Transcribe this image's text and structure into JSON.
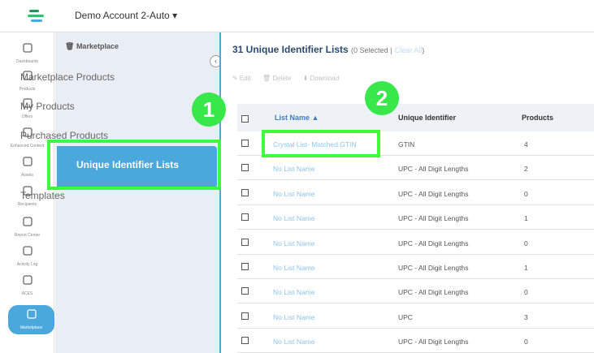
{
  "header": {
    "account_name": "Demo Account 2-Auto ▾"
  },
  "rail": {
    "items": [
      {
        "label": "Dashboards",
        "icon": "dashboard-icon"
      },
      {
        "label": "Products",
        "icon": "products-icon"
      },
      {
        "label": "Offers",
        "icon": "offers-icon"
      },
      {
        "label": "Enhanced Content",
        "icon": "enhanced-content-icon"
      },
      {
        "label": "Assets",
        "icon": "assets-icon"
      },
      {
        "label": "Recipients",
        "icon": "recipients-icon"
      },
      {
        "label": "Report Center",
        "icon": "report-center-icon"
      },
      {
        "label": "Activity Log",
        "icon": "activity-log-icon"
      },
      {
        "label": "ACES",
        "icon": "aces-icon"
      },
      {
        "label": "Marketplace",
        "icon": "marketplace-icon"
      }
    ]
  },
  "subnav": {
    "heading": "Marketplace",
    "items": [
      "Marketplace Products",
      "My Products",
      "Purchased Products",
      "Unique Identifier Lists",
      "Templates"
    ],
    "active_index": 3
  },
  "main": {
    "title_count": "31 Unique Identifier Lists",
    "selected_text": "(0 Selected |",
    "clear_all": "Clear All",
    "close_paren": ")",
    "toolbar": {
      "edit": "✎ Edit",
      "delete": "🗑 Delete",
      "download": "⬇ Download"
    },
    "columns": {
      "name": "List Name ▲",
      "identifier": "Unique Identifier",
      "products": "Products"
    },
    "rows": [
      {
        "name": "Crystal List- Matched GTIN",
        "identifier": "GTIN",
        "products": "4"
      },
      {
        "name": "No List Name",
        "identifier": "UPC - All Digit Lengths",
        "products": "2"
      },
      {
        "name": "No List Name",
        "identifier": "UPC - All Digit Lengths",
        "products": "0"
      },
      {
        "name": "No List Name",
        "identifier": "UPC - All Digit Lengths",
        "products": "1"
      },
      {
        "name": "No List Name",
        "identifier": "UPC - All Digit Lengths",
        "products": "0"
      },
      {
        "name": "No List Name",
        "identifier": "UPC - All Digit Lengths",
        "products": "1"
      },
      {
        "name": "No List Name",
        "identifier": "UPC - All Digit Lengths",
        "products": "0"
      },
      {
        "name": "No List Name",
        "identifier": "UPC",
        "products": "3"
      },
      {
        "name": "No List Name",
        "identifier": "UPC - All Digit Lengths",
        "products": "0"
      }
    ]
  },
  "annotations": {
    "badge_1": "1",
    "badge_2": "2"
  },
  "colors": {
    "accent": "#4aa8dc",
    "highlight": "#3dfa3d",
    "link": "#8ec5ea"
  }
}
